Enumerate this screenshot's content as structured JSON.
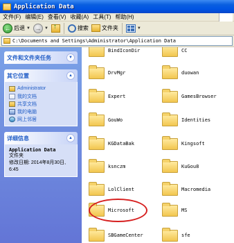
{
  "window": {
    "title": "Application Data"
  },
  "menu": [
    "文件(F)",
    "编辑(E)",
    "查看(V)",
    "收藏(A)",
    "工具(T)",
    "帮助(H)"
  ],
  "toolbar": {
    "back_label": "后退",
    "search_label": "搜索",
    "folders_label": "文件夹"
  },
  "address": {
    "path": "C:\\Documents and Settings\\Administrator\\Application Data"
  },
  "tasks_panel": {
    "title": "文件和文件夹任务"
  },
  "places_panel": {
    "title": "其它位置",
    "items": [
      {
        "label": "Administrator",
        "icon": "folder-icon"
      },
      {
        "label": "我的文档",
        "icon": "documents-icon"
      },
      {
        "label": "共享文档",
        "icon": "shared-documents-icon"
      },
      {
        "label": "我的电脑",
        "icon": "computer-icon"
      },
      {
        "label": "网上邻居",
        "icon": "network-icon"
      }
    ]
  },
  "details_panel": {
    "title": "详细信息",
    "name": "Application Data",
    "type": "文件夹",
    "modified": "修改日期: 2014年8月30日, 6:45"
  },
  "files": [
    {
      "name": "BindIconDir"
    },
    {
      "name": "CC"
    },
    {
      "name": "DrvMgr"
    },
    {
      "name": "duowan"
    },
    {
      "name": "Expert"
    },
    {
      "name": "GamesBrowser"
    },
    {
      "name": "GouWo"
    },
    {
      "name": "Identities"
    },
    {
      "name": "KGDataBak"
    },
    {
      "name": "Kingsoft"
    },
    {
      "name": "ksnczm"
    },
    {
      "name": "KuGou8"
    },
    {
      "name": "LolClient"
    },
    {
      "name": "Macromedia"
    },
    {
      "name": "Microsoft",
      "circled": true
    },
    {
      "name": "MS"
    },
    {
      "name": "SBGameCenter"
    },
    {
      "name": "sfe"
    }
  ],
  "colors": {
    "highlight_circle": "#d61f1f",
    "xp_blue": "#0054e3"
  }
}
